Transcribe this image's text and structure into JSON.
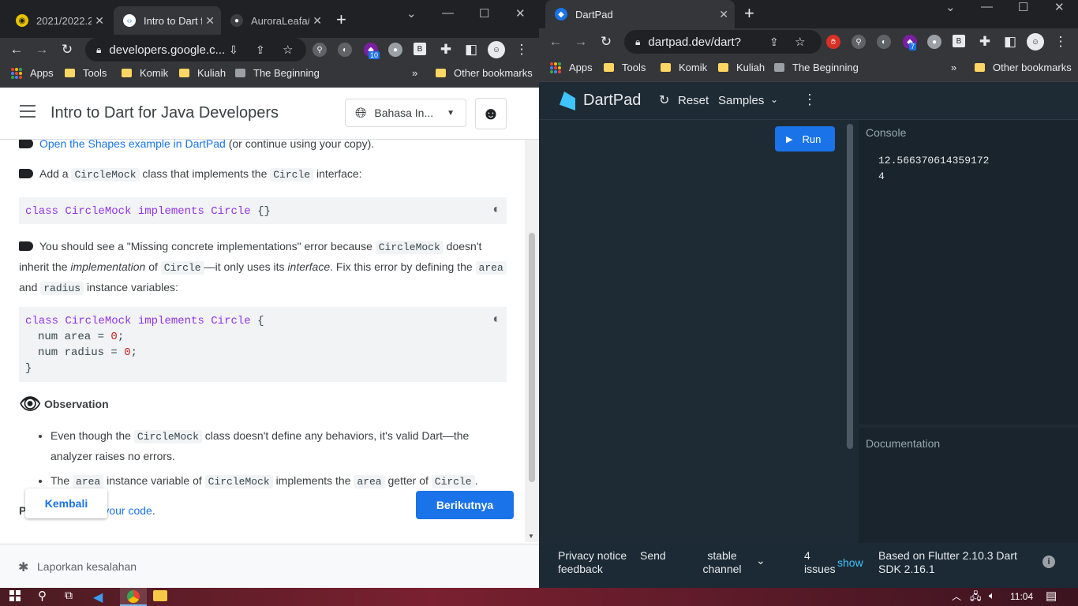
{
  "left": {
    "tabs": [
      {
        "label": "2021/2022.2 /",
        "active": false
      },
      {
        "label": "Intro to Dart f",
        "active": true
      },
      {
        "label": "AuroraLeafa/",
        "active": false
      }
    ],
    "url": "developers.google.c...",
    "ext_badge": "10",
    "bookmarks": [
      "Apps",
      "Tools",
      "Komik",
      "Kuliah",
      "The Beginning"
    ],
    "bookmarks_more": "»",
    "other_bookmarks": "Other bookmarks",
    "page_title": "Intro to Dart for Java Developers",
    "language_label": "Bahasa In...",
    "step_open_link": "Open the Shapes example in DartPad",
    "step_open_rest": "(or continue using your copy).",
    "step_add_pre": "Add a",
    "step_add_code1": "CircleMock",
    "step_add_mid": "class that implements the",
    "step_add_code2": "Circle",
    "step_add_post": "interface:",
    "code1": {
      "k1": "class",
      "t1": "CircleMock",
      "k2": "implements",
      "t2": "Circle",
      "rest": "{}"
    },
    "missing": {
      "p1": "You should see a \"Missing concrete implementations\" error because",
      "c1": "CircleMock",
      "p2": "doesn't inherit the",
      "i1": "implementation",
      "p3": "of",
      "c2": "Circle",
      "p4": "—it only uses its",
      "i2": "interface",
      "p5": ". Fix this error by defining the",
      "c3": "area",
      "p6": "and",
      "c4": "radius",
      "p7": "instance variables:"
    },
    "code2": {
      "l1_k1": "class",
      "l1_t1": "CircleMock",
      "l1_k2": "implements",
      "l1_t2": "Circle",
      "l1_rest": "{",
      "l2_a": "num area = ",
      "l2_n": "0",
      "l2_b": ";",
      "l3_a": "num radius = ",
      "l3_n": "0",
      "l3_b": ";",
      "l4": "}"
    },
    "observation_title": "Observation",
    "bullet1": {
      "p1": "Even though the",
      "c1": "CircleMock",
      "p2": "class doesn't define any behaviors, it's valid Dart—the analyzer raises no errors."
    },
    "bullet2": {
      "p1": "The",
      "c1": "area",
      "p2": "instance variable of",
      "c2": "CircleMock",
      "p3": "implements the",
      "c3": "area",
      "p4": "getter of",
      "c4": "Circle",
      "p5": "."
    },
    "partial_p": "P",
    "partial_link": "your code",
    "partial_dot": ".",
    "back_button": "Kembali",
    "next_button": "Berikutnya",
    "report": "Laporkan kesalahan"
  },
  "right": {
    "tab_label": "DartPad",
    "url": "dartpad.dev/dart?",
    "ext_badge": "7",
    "bookmarks": [
      "Apps",
      "Tools",
      "Komik",
      "Kuliah",
      "The Beginning"
    ],
    "bookmarks_more": "»",
    "other_bookmarks": "Other bookmarks",
    "app_name": "DartPad",
    "reset": "Reset",
    "samples": "Samples",
    "run": "Run",
    "console_title": "Console",
    "console_lines": [
      "12.566370614359172",
      "4"
    ],
    "docs_title": "Documentation",
    "status": {
      "privacy": "Privacy notice",
      "send": "Send",
      "feedback": "feedback",
      "channel": "stable channel",
      "issues_count": "4",
      "issues": "issues",
      "show": "show",
      "flutter": "Based on Flutter 2.10.3 Dart SDK 2.16.1"
    }
  },
  "taskbar": {
    "time": "11:04"
  }
}
